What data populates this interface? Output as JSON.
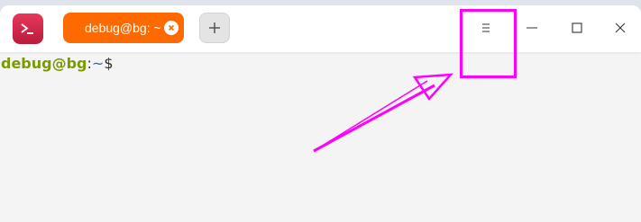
{
  "window": {
    "tab": {
      "label": "debug@bg: ~"
    },
    "icons": {
      "app": "terminal-app-icon",
      "tab_close": "close-icon",
      "new_tab": "plus-icon",
      "menu": "hamburger-menu-icon",
      "minimize": "minimize-icon",
      "maximize": "maximize-icon",
      "close": "close-icon"
    }
  },
  "terminal": {
    "prompt_user": "debug@bg",
    "prompt_colon": ":",
    "prompt_path": "~",
    "prompt_dollar": "$"
  },
  "colors": {
    "tab_active": "#ff6a00",
    "app_icon": "#d62f4f",
    "prompt_user": "#7a9a01",
    "prompt_path": "#3465a4",
    "annotation": "#ff00ff"
  }
}
